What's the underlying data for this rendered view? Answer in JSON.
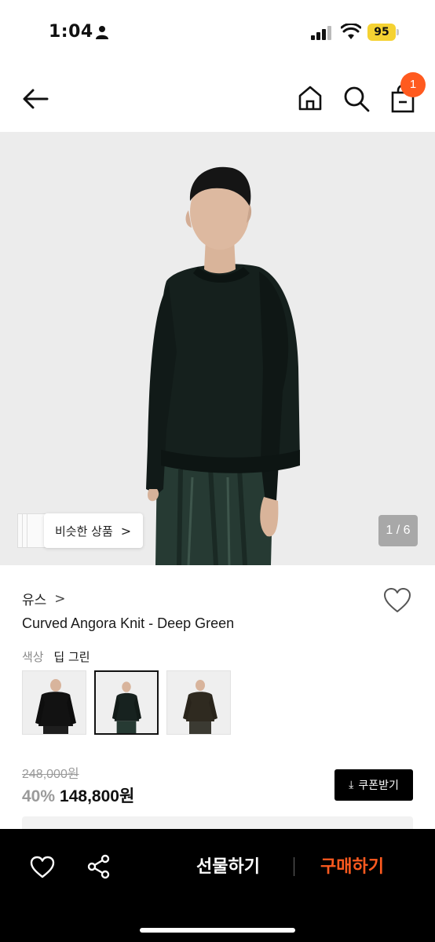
{
  "status_bar": {
    "time": "1:04",
    "battery": "95"
  },
  "header": {
    "cart_count": "1",
    "icons": [
      "back-arrow-icon",
      "home-icon",
      "search-icon",
      "shopping-bag-icon"
    ]
  },
  "gallery": {
    "similar_label": "비슷한 상품",
    "similar_chevron": ">",
    "counter": "1 / 6"
  },
  "product": {
    "brand": "유스",
    "brand_chevron": ">",
    "name": "Curved Angora Knit - Deep Green",
    "color_label": "색상",
    "color_value": "딥 그린",
    "swatches": [
      "black",
      "deep-green",
      "brown"
    ],
    "selected_swatch": 1,
    "original_price": "248,000원",
    "discount": "40%",
    "price": "148,800원",
    "coupon_label": "쿠폰받기"
  },
  "bottom_bar": {
    "gift_label": "선물하기",
    "buy_label": "구매하기",
    "accent_color": "#ff5a1f"
  }
}
